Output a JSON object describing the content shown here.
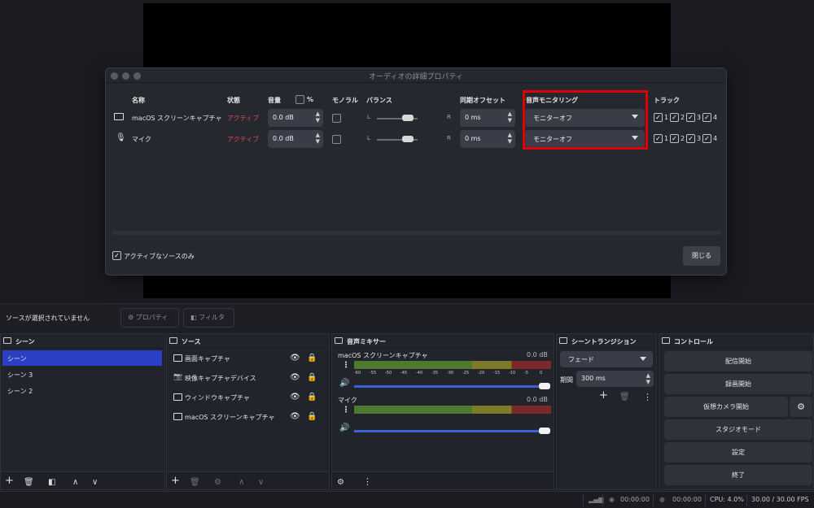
{
  "dialog": {
    "title": "オーディオの詳細プロパティ",
    "headers": {
      "name": "名称",
      "status": "状態",
      "volume": "音量",
      "percent": "%",
      "mono": "モノラル",
      "balance": "バランス",
      "sync_offset": "同期オフセット",
      "monitoring": "音声モニタリング",
      "tracks": "トラック"
    },
    "rows": [
      {
        "name": "macOS スクリーンキャプチャ",
        "status": "アクティブ",
        "volume": "0.0 dB",
        "balance_left": "L",
        "balance_right": "R",
        "offset": "0 ms",
        "monitoring": "モニターオフ",
        "tracks": [
          "1",
          "2",
          "3",
          "4"
        ]
      },
      {
        "name": "マイク",
        "status": "アクティブ",
        "volume": "0.0 dB",
        "balance_left": "L",
        "balance_right": "R",
        "offset": "0 ms",
        "monitoring": "モニターオフ",
        "tracks": [
          "1",
          "2",
          "3",
          "4"
        ]
      }
    ],
    "active_only_label": "アクティブなソースのみ",
    "close_label": "閉じる"
  },
  "toolbar": {
    "no_source": "ソースが選択されていません",
    "properties": "プロパティ",
    "filters": "フィルタ"
  },
  "scenes": {
    "title": "シーン",
    "items": [
      "シーン",
      "シーン 3",
      "シーン 2"
    ],
    "selected": 0
  },
  "sources": {
    "title": "ソース",
    "items": [
      "画面キャプチャ",
      "映像キャプチャデバイス",
      "ウィンドウキャプチャ",
      "macOS スクリーンキャプチャ"
    ]
  },
  "mixer": {
    "title": "音声ミキサー",
    "channels": [
      {
        "name": "macOS スクリーンキャプチャ",
        "db": "0.0 dB"
      },
      {
        "name": "マイク",
        "db": "0.0 dB"
      }
    ],
    "ticks": [
      "-60",
      "-55",
      "-50",
      "-45",
      "-40",
      "-35",
      "-30",
      "-25",
      "-20",
      "-15",
      "-10",
      "-5",
      "0"
    ]
  },
  "transitions": {
    "title": "シーントランジション",
    "type": "フェード",
    "duration_label": "期間",
    "duration": "300 ms"
  },
  "controls": {
    "title": "コントロール",
    "buttons": [
      "配信開始",
      "録画開始",
      "仮想カメラ開始",
      "スタジオモード",
      "設定",
      "終了"
    ]
  },
  "status": {
    "rec_time": "00:00:00",
    "stream_time": "00:00:00",
    "cpu": "CPU: 4.0%",
    "fps": "30.00 / 30.00 FPS"
  },
  "colors": {
    "accent_selected": "#2a3fc4",
    "active_text": "#e0484f",
    "highlight_box": "#e10000"
  }
}
